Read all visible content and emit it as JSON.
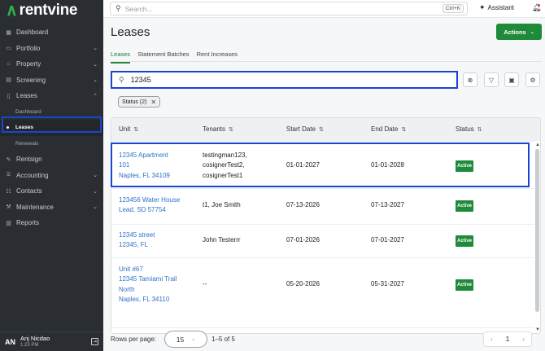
{
  "sidebar": {
    "brand": "rentvine",
    "items": [
      {
        "label": "Dashboard",
        "icon": "dashboard-icon",
        "chevron": false
      },
      {
        "label": "Portfolio",
        "icon": "folder-icon",
        "chevron": true
      },
      {
        "label": "Property",
        "icon": "home-icon",
        "chevron": true
      },
      {
        "label": "Screening",
        "icon": "clipboard-icon",
        "chevron": true
      },
      {
        "label": "Leases",
        "icon": "document-icon",
        "chevron": true,
        "expanded": true
      }
    ],
    "leases_sub": [
      "Dashboard",
      "Leases",
      "Renewals"
    ],
    "items_after": [
      {
        "label": "Rentsign",
        "icon": "signature-icon",
        "chevron": false
      },
      {
        "label": "Accounting",
        "icon": "bank-icon",
        "chevron": true
      },
      {
        "label": "Contacts",
        "icon": "contacts-icon",
        "chevron": true
      },
      {
        "label": "Maintenance",
        "icon": "wrench-icon",
        "chevron": true
      },
      {
        "label": "Reports",
        "icon": "chart-icon",
        "chevron": false
      }
    ],
    "user": {
      "initials": "AN",
      "name": "Anj Nicdao",
      "time": "1:23 PM"
    }
  },
  "topbar": {
    "search_placeholder": "Search...",
    "shortcut": "Ctrl+K",
    "assistant": "Assistant"
  },
  "main": {
    "title": "Leases",
    "actions_label": "Actions",
    "tabs": [
      "Leases",
      "Statement Batches",
      "Rent Increases"
    ],
    "filter_value": "12345",
    "chip": "Status (2)",
    "columns": [
      "Unit",
      "Tenants",
      "Start Date",
      "End Date",
      "Status"
    ],
    "rows": [
      {
        "unit": [
          "12345 Apartment",
          "101",
          "Naples, FL 34109"
        ],
        "tenants": [
          "testingman123,",
          "cosignerTest2,",
          "cosignerTest1"
        ],
        "start": "01-01-2027",
        "end": "01-01-2028",
        "status": "Active"
      },
      {
        "unit": [
          "123456 Water House",
          "Lead, SD 57754"
        ],
        "tenants": [
          "t1, Joe Smith"
        ],
        "start": "07-13-2026",
        "end": "07-13-2027",
        "status": "Active"
      },
      {
        "unit": [
          "12345 street",
          "12345, FL"
        ],
        "tenants": [
          "John Testerrr"
        ],
        "start": "07-01-2026",
        "end": "07-01-2027",
        "status": "Active"
      },
      {
        "unit": [
          "Unit #67",
          "12345 Tamiami Trail",
          "North",
          "Naples, FL 34110"
        ],
        "tenants": [
          "--"
        ],
        "start": "05-20-2026",
        "end": "05-31-2027",
        "status": "Active"
      }
    ],
    "footer": {
      "rows_per_page_label": "Rows per page:",
      "rows_per_page": "15",
      "range": "1–5 of 5",
      "page": "1"
    }
  },
  "colors": {
    "accent": "#1e8a3a",
    "highlight": "#1746d1",
    "link": "#2f72c8",
    "sidebar": "#2a2e33"
  }
}
